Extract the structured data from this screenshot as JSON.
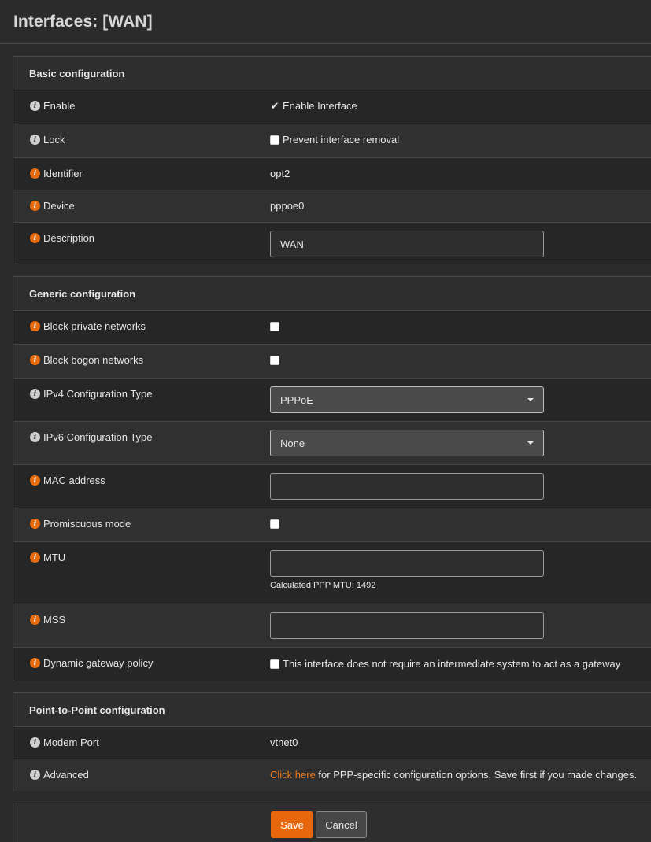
{
  "page": {
    "title": "Interfaces: [WAN]"
  },
  "basic": {
    "title": "Basic configuration",
    "enable": {
      "label": "Enable",
      "text": "Enable Interface"
    },
    "lock": {
      "label": "Lock",
      "text": "Prevent interface removal"
    },
    "identifier": {
      "label": "Identifier",
      "value": "opt2"
    },
    "device": {
      "label": "Device",
      "value": "pppoe0"
    },
    "description": {
      "label": "Description",
      "value": "WAN"
    }
  },
  "generic": {
    "title": "Generic configuration",
    "block_private": {
      "label": "Block private networks"
    },
    "block_bogon": {
      "label": "Block bogon networks"
    },
    "ipv4": {
      "label": "IPv4 Configuration Type",
      "value": "PPPoE"
    },
    "ipv6": {
      "label": "IPv6 Configuration Type",
      "value": "None"
    },
    "mac": {
      "label": "MAC address",
      "value": ""
    },
    "promisc": {
      "label": "Promiscuous mode"
    },
    "mtu": {
      "label": "MTU",
      "value": "",
      "hint": "Calculated PPP MTU: 1492"
    },
    "mss": {
      "label": "MSS",
      "value": ""
    },
    "dyngw": {
      "label": "Dynamic gateway policy",
      "text": "This interface does not require an intermediate system to act as a gateway"
    }
  },
  "ptp": {
    "title": "Point-to-Point configuration",
    "modem": {
      "label": "Modem Port",
      "value": "vtnet0"
    },
    "advanced": {
      "label": "Advanced",
      "link": "Click here",
      "text": " for PPP-specific configuration options. Save first if you made changes."
    }
  },
  "actions": {
    "save": "Save",
    "cancel": "Cancel"
  },
  "colors": {
    "accent": "#e8670c",
    "info_orange": "#e66c0f",
    "info_grey": "#cfcfcf"
  },
  "icons": {
    "info": "i",
    "check": "✔"
  }
}
